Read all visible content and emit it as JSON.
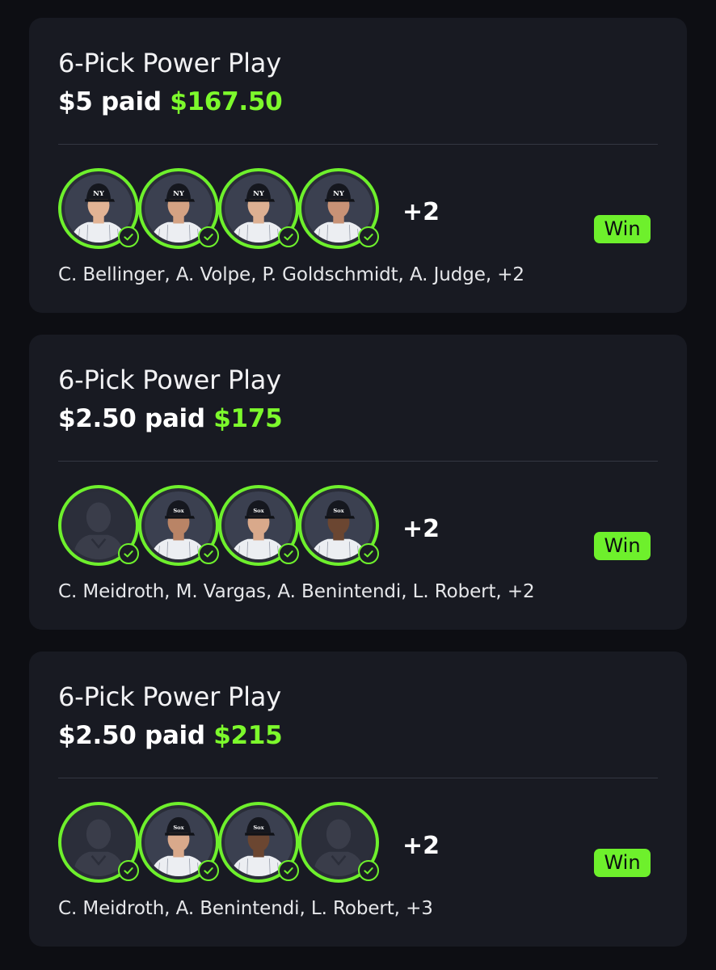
{
  "cards": [
    {
      "title": "6-Pick Power Play",
      "paid": "$5 paid",
      "payout": "$167.50",
      "more_count": "+2",
      "status": "Win",
      "players_text": "C. Bellinger, A. Volpe, P. Goldschmidt, A. Judge, +2",
      "avatars": [
        {
          "player": "C. Bellinger",
          "team": "NY",
          "photo": "player",
          "skin": "#e2b394",
          "checked": true
        },
        {
          "player": "A. Volpe",
          "team": "NY",
          "photo": "player",
          "skin": "#d4a283",
          "checked": true
        },
        {
          "player": "P. Goldschmidt",
          "team": "NY",
          "photo": "player",
          "skin": "#ddb092",
          "checked": true
        },
        {
          "player": "A. Judge",
          "team": "NY",
          "photo": "player",
          "skin": "#c89276",
          "checked": true
        }
      ]
    },
    {
      "title": "6-Pick Power Play",
      "paid": "$2.50 paid",
      "payout": "$175",
      "more_count": "+2",
      "status": "Win",
      "players_text": "C. Meidroth, M. Vargas, A. Benintendi, L. Robert, +2",
      "avatars": [
        {
          "player": "C. Meidroth",
          "team": "",
          "photo": "silhouette",
          "skin": "",
          "checked": true
        },
        {
          "player": "M. Vargas",
          "team": "Sox",
          "photo": "player",
          "skin": "#b98466",
          "checked": true
        },
        {
          "player": "A. Benintendi",
          "team": "Sox",
          "photo": "player",
          "skin": "#d9a98b",
          "checked": true
        },
        {
          "player": "L. Robert",
          "team": "Sox",
          "photo": "player",
          "skin": "#6b4631",
          "checked": true
        }
      ]
    },
    {
      "title": "6-Pick Power Play",
      "paid": "$2.50 paid",
      "payout": "$215",
      "more_count": "+2",
      "status": "Win",
      "players_text": "C. Meidroth, A. Benintendi, L. Robert, +3",
      "avatars": [
        {
          "player": "C. Meidroth",
          "team": "",
          "photo": "silhouette",
          "skin": "",
          "checked": true
        },
        {
          "player": "A. Benintendi",
          "team": "Sox",
          "photo": "player",
          "skin": "#d9a98b",
          "checked": true
        },
        {
          "player": "L. Robert",
          "team": "Sox",
          "photo": "player",
          "skin": "#6b4631",
          "checked": true
        },
        {
          "player": "",
          "team": "",
          "photo": "silhouette",
          "skin": "",
          "checked": true
        }
      ]
    }
  ],
  "colors": {
    "background": "#0d0e13",
    "card": "#181a22",
    "accent_green": "#6ef02c",
    "payout_green": "#7dfa2c"
  },
  "icons": {
    "check": "check-circle-icon",
    "silhouette": "player-silhouette-icon"
  }
}
